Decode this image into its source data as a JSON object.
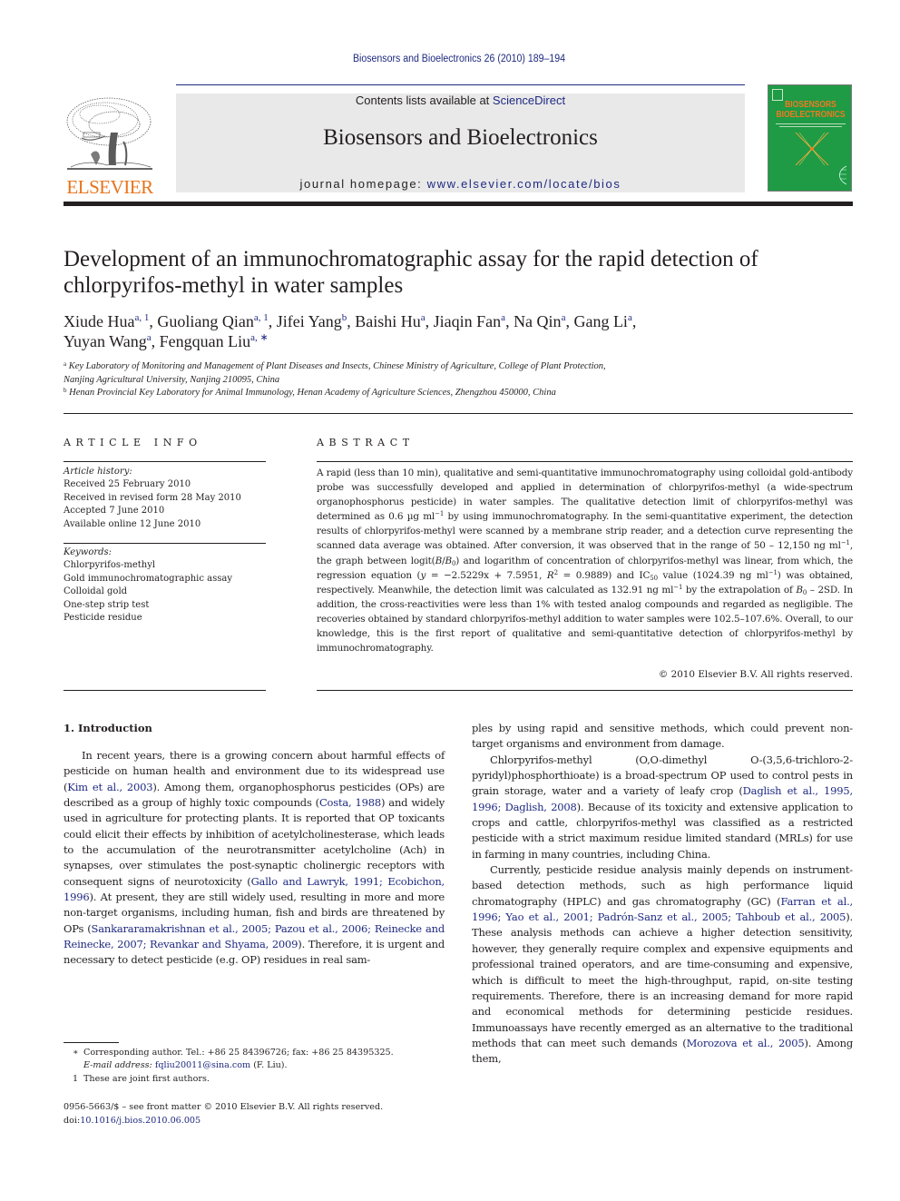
{
  "running_head": "Biosensors and Bioelectronics 26 (2010) 189–194",
  "masthead": {
    "publisher_logo_text": "ELSEVIER",
    "contents_prefix": "Contents lists available at ",
    "contents_link": "ScienceDirect",
    "journal_title": "Biosensors and Bioelectronics",
    "homepage_prefix": "journal homepage: ",
    "homepage_link": "www.elsevier.com/locate/bios",
    "cover_title_line1": "BIOSENSORS",
    "cover_title_line2": "BIOELECTRONICS",
    "colors": {
      "link": "#1f2a80",
      "elsevier_orange": "#e8731b",
      "cover_green": "#1f9a45",
      "masthead_gray": "#e9e9ea"
    }
  },
  "article": {
    "title": "Development of an immunochromatographic assay for the rapid detection of chlorpyrifos-methyl in water samples",
    "authors": [
      {
        "name": "Xiude Hua",
        "marks": "a, 1"
      },
      {
        "name": "Guoliang Qian",
        "marks": "a, 1"
      },
      {
        "name": "Jifei Yang",
        "marks": "b"
      },
      {
        "name": "Baishi Hu",
        "marks": "a"
      },
      {
        "name": "Jiaqin Fan",
        "marks": "a"
      },
      {
        "name": "Na Qin",
        "marks": "a"
      },
      {
        "name": "Gang Li",
        "marks": "a"
      },
      {
        "name": "Yuyan Wang",
        "marks": "a"
      },
      {
        "name": "Fengquan Liu",
        "marks": "a, ∗"
      }
    ],
    "affiliations": [
      {
        "mark": "a",
        "line1": "Key Laboratory of Monitoring and Management of Plant Diseases and Insects, Chinese Ministry of Agriculture, College of Plant Protection,",
        "line2": "Nanjing Agricultural University, Nanjing 210095, China"
      },
      {
        "mark": "b",
        "line1": "Henan Provincial Key Laboratory for Animal Immunology, Henan Academy of Agriculture Sciences, Zhengzhou 450000, China"
      }
    ]
  },
  "article_info": {
    "heading": "ARTICLE INFO",
    "history_label": "Article history:",
    "history": [
      "Received 25 February 2010",
      "Received in revised form 28 May 2010",
      "Accepted 7 June 2010",
      "Available online 12 June 2010"
    ],
    "keywords_label": "Keywords:",
    "keywords": [
      "Chlorpyrifos-methyl",
      "Gold immunochromatographic assay",
      "Colloidal gold",
      "One-step strip test",
      "Pesticide residue"
    ]
  },
  "abstract": {
    "heading": "ABSTRACT",
    "p1": "A rapid (less than 10 min), qualitative and semi-quantitative immunochromatography using colloidal gold-antibody probe was successfully developed and applied in determination of chlorpyrifos-methyl (a wide-spectrum organophosphorus pesticide) in water samples. The qualitative detection limit of chlorpyrifos-methyl was determined as 0.6 µg ml",
    "p2": " by using immunochromatography. In the semi-quantitative experiment, the detection results of chlorpyrifos-methyl were scanned by a membrane strip reader, and a detection curve representing the scanned data average was obtained. After conversion, it was observed that in the range of 50 – 12,150 ng ml",
    "p3": ", the graph between logit(",
    "p4": ") and logarithm of concentration of chlorpyrifos-methyl was linear, from which, the regression equation (",
    "p5": " = −2.5229x + 7.5951, ",
    "p6": " = 0.9889) and IC",
    "p7": " value (1024.39 ng ml",
    "p8": ") was obtained, respectively. Meanwhile, the detection limit was calculated as 132.91 ng ml",
    "p9": " by the extrapolation of ",
    "p10": " – 2SD. In addition, the cross-reactivities were less than 1% with tested analog compounds and regarded as negligible. The recoveries obtained by standard chlorpyrifos-methyl addition to water samples were 102.5–107.6%. Overall, to our knowledge, this is the first report of qualitative and semi-quantitative detection of chlorpyrifos-methyl by immunochromatography.",
    "sup_minus1": "−1",
    "sup_2": "2",
    "sub_0": "0",
    "sub_50": "50",
    "var_B": "B",
    "var_B0": "B",
    "var_y": "y",
    "var_R": "R",
    "copyright": "© 2010 Elsevier B.V. All rights reserved."
  },
  "intro": {
    "heading": "1.  Introduction",
    "left_p1_a": "In recent years, there is a growing concern about harmful effects of pesticide on human health and environment due to its widespread use (",
    "left_p1_c1": "Kim et al., 2003",
    "left_p1_b": "). Among them, organophosphorus pesticides (OPs) are described as a group of highly toxic compounds (",
    "left_p1_c2": "Costa, 1988",
    "left_p1_c": ") and widely used in agriculture for protecting plants. It is reported that OP toxicants could elicit their effects by inhibition of acetylcholinesterase, which leads to the accumulation of the neurotransmitter acetylcholine (Ach) in synapses, over stimulates the post-synaptic cholinergic receptors with consequent signs of neurotoxicity (",
    "left_p1_c3": "Gallo and Lawryk, 1991; Ecobichon, 1996",
    "left_p1_d": "). At present, they are still widely used, resulting in more and more non-target organisms, including human, fish and birds are threatened by OPs (",
    "left_p1_c4": "Sankararamakrishnan et al., 2005; Pazou et al., 2006; Reinecke and Reinecke, 2007; Revankar and Shyama, 2009",
    "left_p1_e": "). Therefore, it is urgent and necessary to detect pesticide (e.g. OP) residues in real sam-",
    "right_p1": "ples by using rapid and sensitive methods, which could prevent non-target organisms and environment from damage.",
    "right_p2_a": "Chlorpyrifos-methyl (O,O-dimethyl O-(3,5,6-trichloro-2-pyridyl)phosphorthioate) is a broad-spectrum OP used to control pests in grain storage, water and a variety of leafy crop (",
    "right_p2_c1": "Daglish et al., 1995, 1996; Daglish, 2008",
    "right_p2_b": "). Because of its toxicity and extensive application to crops and cattle, chlorpyrifos-methyl was classified as a restricted pesticide with a strict maximum residue limited standard (MRLs) for use in farming in many countries, including China.",
    "right_p3_a": "Currently, pesticide residue analysis mainly depends on instrument-based detection methods, such as high performance liquid chromatography (HPLC) and gas chromatography (GC) (",
    "right_p3_c1": "Farran et al., 1996; Yao et al., 2001; Padrón-Sanz et al., 2005; Tahboub et al., 2005",
    "right_p3_b": "). These analysis methods can achieve a higher detection sensitivity, however, they generally require complex and expensive equipments and professional trained operators, and are time-consuming and expensive, which is difficult to meet the high-throughput, rapid, on-site testing requirements. Therefore, there is an increasing demand for more rapid and economical methods for determining pesticide residues. Immunoassays have recently emerged as an alternative to the traditional methods that can meet such demands (",
    "right_p3_c2": "Morozova et al., 2005",
    "right_p3_c": "). Among them,"
  },
  "footnotes": {
    "corresponding_mark": "∗",
    "corresponding_text": "Corresponding author. Tel.: +86 25 84396726; fax: +86 25 84395325.",
    "email_label": "E-mail address: ",
    "email": "fqliu20011@sina.com",
    "email_suffix": " (F. Liu).",
    "joint_mark": "1",
    "joint_text": "These are joint first authors."
  },
  "front_matter": {
    "line1": "0956-5663/$ – see front matter © 2010 Elsevier B.V. All rights reserved.",
    "doi_prefix": "doi:",
    "doi": "10.1016/j.bios.2010.06.005"
  }
}
